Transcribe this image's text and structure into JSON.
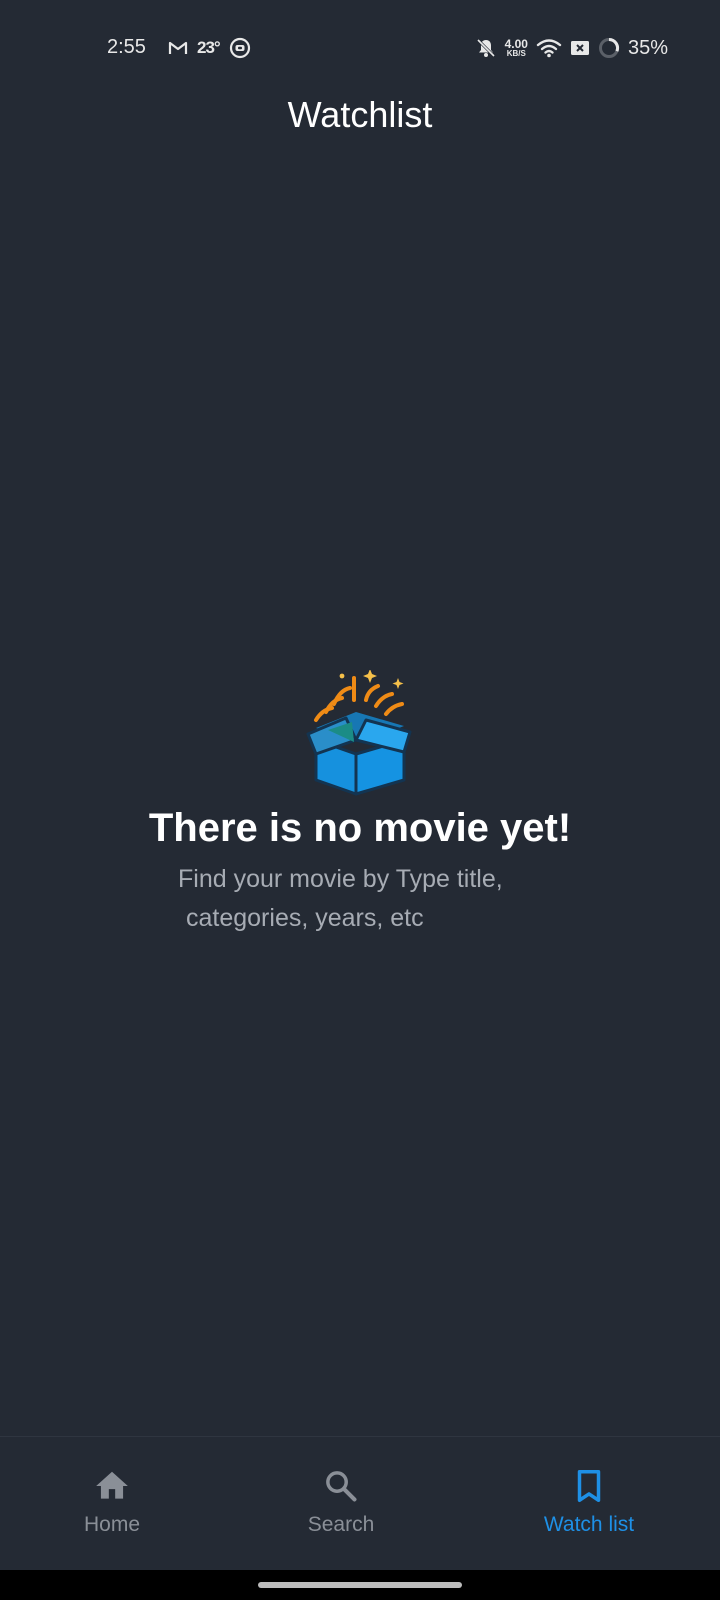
{
  "status_bar": {
    "time": "2:55",
    "temperature": "23°",
    "net_speed_value": "4.00",
    "net_speed_unit": "KB/S",
    "battery": "35%",
    "icons": [
      "gmail-icon",
      "weather-icon",
      "notification-app-icon",
      "bell-off-icon",
      "wifi-icon",
      "sim-off-icon",
      "battery-icon"
    ]
  },
  "header": {
    "title": "Watchlist"
  },
  "empty_state": {
    "icon": "open-box-icon",
    "title": "There is no movie yet!",
    "subtitle_line1": "Find your movie by Type title,",
    "subtitle_line2": "categories, years, etc"
  },
  "bottom_nav": {
    "items": [
      {
        "label": "Home",
        "icon": "home-icon",
        "active": false
      },
      {
        "label": "Search",
        "icon": "search-icon",
        "active": false
      },
      {
        "label": "Watch list",
        "icon": "bookmark-icon",
        "active": true
      }
    ]
  },
  "colors": {
    "background": "#242a34",
    "accent": "#1e90e6",
    "inactive": "#8a8f97",
    "subtitle": "#a7acb4"
  }
}
